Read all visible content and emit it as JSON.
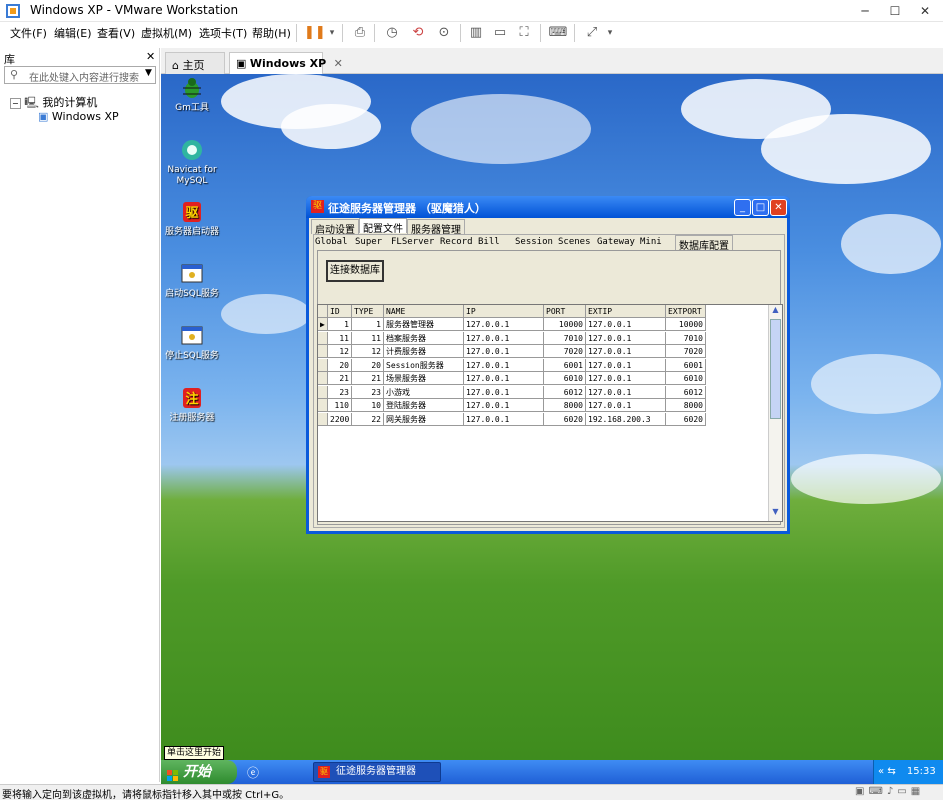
{
  "window": {
    "title": "Windows XP - VMware Workstation"
  },
  "menu": [
    "文件(F)",
    "编辑(E)",
    "查看(V)",
    "虚拟机(M)",
    "选项卡(T)",
    "帮助(H)"
  ],
  "library": {
    "header": "库",
    "search_placeholder": "在此处键入内容进行搜索",
    "tree": {
      "root": "我的计算机",
      "child": "Windows XP"
    }
  },
  "tabs": [
    {
      "label": "主页"
    },
    {
      "label": "Windows XP"
    }
  ],
  "desktop_icons": [
    "Gm工具",
    "Navicat for MySQL",
    "服务器启动器",
    "启动SQL服务",
    "停止SQL服务",
    "注册服务器"
  ],
  "app": {
    "title": "征途服务器管理器  （驱魔猎人）",
    "tabs_top": [
      "启动设置",
      "配置文件",
      "服务器管理"
    ],
    "tabs_sub": [
      "Global",
      "Super",
      "FLServer",
      "Record",
      "Bill",
      "Session",
      "Scenes",
      "Gateway",
      "Mini",
      "数据库配置"
    ],
    "connect_button": "连接数据库",
    "grid": {
      "columns": [
        "ID",
        "TYPE",
        "NAME",
        "IP",
        "PORT",
        "EXTIP",
        "EXTPORT"
      ],
      "rows": [
        [
          "1",
          "1",
          "服务器管理器",
          "127.0.0.1",
          "10000",
          "127.0.0.1",
          "10000"
        ],
        [
          "11",
          "11",
          "档案服务器",
          "127.0.0.1",
          "7010",
          "127.0.0.1",
          "7010"
        ],
        [
          "12",
          "12",
          "计费服务器",
          "127.0.0.1",
          "7020",
          "127.0.0.1",
          "7020"
        ],
        [
          "20",
          "20",
          "Session服务器",
          "127.0.0.1",
          "6001",
          "127.0.0.1",
          "6001"
        ],
        [
          "21",
          "21",
          "场景服务器",
          "127.0.0.1",
          "6010",
          "127.0.0.1",
          "6010"
        ],
        [
          "23",
          "23",
          "小游戏",
          "127.0.0.1",
          "6012",
          "127.0.0.1",
          "6012"
        ],
        [
          "110",
          "10",
          "登陆服务器",
          "127.0.0.1",
          "8000",
          "127.0.0.1",
          "8000"
        ],
        [
          "2200",
          "22",
          "网关服务器",
          "127.0.0.1",
          "6020",
          "192.168.200.3",
          "6020"
        ]
      ]
    }
  },
  "taskbar": {
    "start": "开始",
    "task": "征途服务器管理器",
    "clock": "15:33",
    "tooltip": "单击这里开始"
  },
  "status": "要将输入定向到该虚拟机，请将鼠标指针移入其中或按 Ctrl+G。"
}
